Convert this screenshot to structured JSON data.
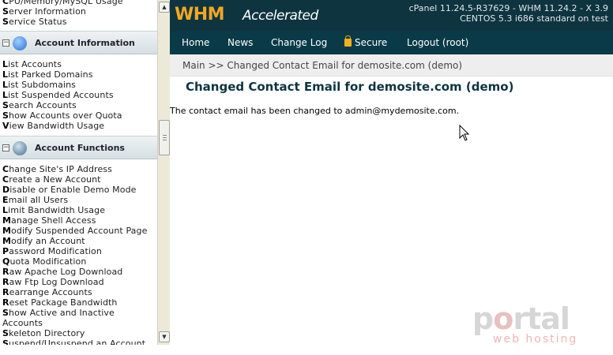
{
  "sidebar": {
    "top_items": [
      {
        "bold": "C",
        "rest": "PU/Memory/MySQL Usage"
      },
      {
        "bold": "S",
        "rest": "erver Information"
      },
      {
        "bold": "S",
        "rest": "ervice Status"
      }
    ],
    "sections": [
      {
        "title": "Account Information",
        "icon": "info-icon",
        "items": [
          {
            "bold": "L",
            "rest": "ist Accounts"
          },
          {
            "bold": "L",
            "rest": "ist Parked Domains"
          },
          {
            "bold": "L",
            "rest": "ist Subdomains"
          },
          {
            "bold": "L",
            "rest": "ist Suspended Accounts"
          },
          {
            "bold": "S",
            "rest": "earch Accounts"
          },
          {
            "bold": "S",
            "rest": "how Accounts over Quota"
          },
          {
            "bold": "V",
            "rest": "iew Bandwidth Usage"
          }
        ]
      },
      {
        "title": "Account Functions",
        "icon": "account-functions-icon",
        "items": [
          {
            "bold": "C",
            "rest": "hange Site's IP Address"
          },
          {
            "bold": "C",
            "rest": "reate a New Account"
          },
          {
            "bold": "D",
            "rest": "isable or Enable Demo Mode"
          },
          {
            "bold": "E",
            "rest": "mail all Users"
          },
          {
            "bold": "L",
            "rest": "imit Bandwidth Usage"
          },
          {
            "bold": "M",
            "rest": "anage Shell Access"
          },
          {
            "bold": "M",
            "rest": "odify Suspended Account Page"
          },
          {
            "bold": "M",
            "rest": "odify an Account"
          },
          {
            "bold": "P",
            "rest": "assword Modification"
          },
          {
            "bold": "Q",
            "rest": "uota Modification"
          },
          {
            "bold": "R",
            "rest": "aw Apache Log Download"
          },
          {
            "bold": "R",
            "rest": "aw Ftp Log Download"
          },
          {
            "bold": "R",
            "rest": "earrange Accounts"
          },
          {
            "bold": "R",
            "rest": "eset Package Bandwidth"
          },
          {
            "bold": "S",
            "rest": "how Active and Inactive"
          },
          {
            "bold": "",
            "rest": "Accounts"
          },
          {
            "bold": "S",
            "rest": "keleton Directory"
          },
          {
            "bold": "S",
            "rest": "uspend/Unsuspend an Account"
          }
        ]
      }
    ],
    "collapse_symbol": "−"
  },
  "header": {
    "logo_main": "WHM",
    "logo_sub": "Accelerated",
    "version_line1": "cPanel 11.24.5-R37629 - WHM 11.24.2 - X 3.9",
    "version_line2": "CENTOS 5.3 i686 standard on test",
    "bg_color": "#0e3440",
    "accent_color": "#f5a623"
  },
  "nav": {
    "home": "Home",
    "news": "News",
    "change_log": "Change Log",
    "secure": "Secure",
    "logout": "Logout (root)"
  },
  "breadcrumb": "Main >> Changed Contact Email for demosite.com (demo)",
  "page_title": "Changed Contact Email for demosite.com (demo)",
  "message": "The contact email has been changed to admin@mydemosite.com.",
  "watermark": {
    "word_a": "p",
    "word_o": "o",
    "word_b": "rtal",
    "sub": "web hosting"
  },
  "scrollbar": {
    "up": "▲",
    "down": "▼"
  }
}
